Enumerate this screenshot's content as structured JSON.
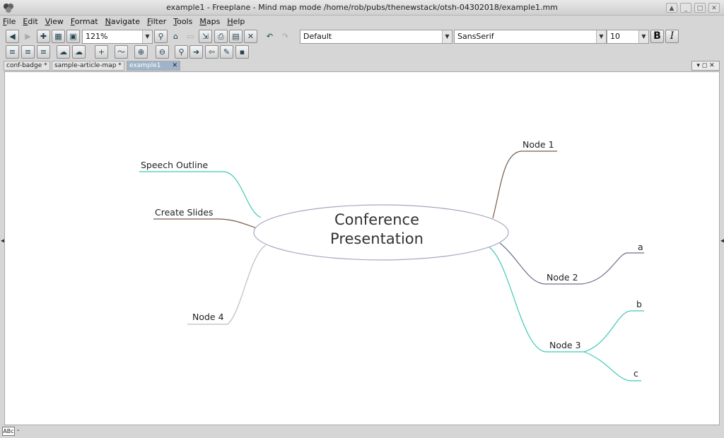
{
  "window": {
    "title": "example1 - Freeplane - Mind map mode /home/rob/pubs/thenewstack/otsh-04302018/example1.mm",
    "controls": [
      "▲",
      "_",
      "□",
      "✕"
    ]
  },
  "menubar": {
    "items": [
      {
        "label": "File"
      },
      {
        "label": "Edit"
      },
      {
        "label": "View"
      },
      {
        "label": "Format"
      },
      {
        "label": "Navigate"
      },
      {
        "label": "Filter"
      },
      {
        "label": "Tools"
      },
      {
        "label": "Maps"
      },
      {
        "label": "Help"
      }
    ]
  },
  "toolbar": {
    "zoom": "121%",
    "style": "Default",
    "font": "SansSerif",
    "font_size": "10",
    "bold_label": "B",
    "italic_label": "I"
  },
  "tabs": [
    {
      "label": "conf-badge *",
      "active": false
    },
    {
      "label": "sample-article-map *",
      "active": false
    },
    {
      "label": "example1",
      "active": true
    }
  ],
  "tab_controls": "▾ ◻ ✕",
  "mindmap": {
    "root": {
      "line1": "Conference",
      "line2": "Presentation"
    },
    "nodes": {
      "speech_outline": "Speech Outline",
      "create_slides": "Create Slides",
      "node4": "Node 4",
      "node1": "Node 1",
      "node2": "Node 2",
      "node3": "Node 3",
      "a": "a",
      "b": "b",
      "c": "c"
    },
    "colors": {
      "teal": "#3ec9b4",
      "brown": "#7a5a4a",
      "slate": "#6b6f8c",
      "gray": "#bdbdbd",
      "root_outline": "#a7a7c2"
    }
  },
  "statusbar": {
    "mode_icon": "ABc",
    "text": "-"
  }
}
